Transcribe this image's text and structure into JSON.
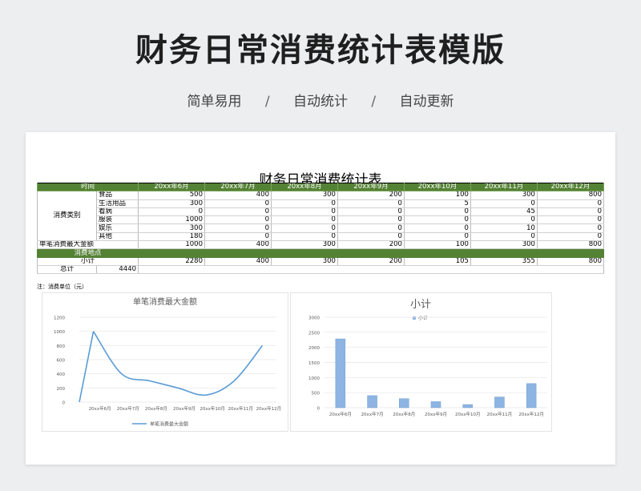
{
  "header": {
    "title": "财务日常消费统计表模版",
    "tags": [
      "简单易用",
      "自动统计",
      "自动更新"
    ],
    "separator": "/"
  },
  "sheet": {
    "title": "财务日常消费统计表",
    "columns": [
      "时间",
      "20xx年6月",
      "20xx年7月",
      "20xx年8月",
      "20xx年9月",
      "20xx年10月",
      "20xx年11月",
      "20xx年12月"
    ],
    "category_label": "消费类别",
    "categories": [
      {
        "name": "食品",
        "values": [
          "500",
          "400",
          "300",
          "200",
          "100",
          "300",
          "800"
        ]
      },
      {
        "name": "生活用品",
        "values": [
          "300",
          "0",
          "0",
          "0",
          "5",
          "0",
          "0"
        ]
      },
      {
        "name": "看病",
        "values": [
          "0",
          "0",
          "0",
          "0",
          "0",
          "45",
          "0"
        ]
      },
      {
        "name": "服装",
        "values": [
          "1000",
          "0",
          "0",
          "0",
          "0",
          "0",
          "0"
        ]
      },
      {
        "name": "娱乐",
        "values": [
          "300",
          "0",
          "0",
          "0",
          "0",
          "10",
          "0"
        ]
      },
      {
        "name": "其他",
        "values": [
          "180",
          "0",
          "0",
          "0",
          "0",
          "0",
          "0"
        ]
      }
    ],
    "max_row": {
      "label": "单笔消费最大金额",
      "values": [
        "1000",
        "400",
        "300",
        "200",
        "100",
        "300",
        "800"
      ]
    },
    "place_row": {
      "label": "消费地点"
    },
    "subtotal_row": {
      "label": "小计",
      "values": [
        "2280",
        "400",
        "300",
        "200",
        "105",
        "355",
        "800"
      ]
    },
    "total_row": {
      "label": "总计",
      "value": "4440"
    },
    "note": "注：消费单位（元）"
  },
  "chart_data": [
    {
      "type": "line",
      "title": "单笔消费最大金额",
      "categories": [
        "20xx年6月",
        "20xx年7月",
        "20xx年8月",
        "20xx年9月",
        "20xx年10月",
        "20xx年11月",
        "20xx年12月"
      ],
      "series": [
        {
          "name": "单笔消费最大金额",
          "values": [
            1000,
            400,
            300,
            200,
            100,
            300,
            800
          ]
        }
      ],
      "ylim": [
        0,
        1200
      ],
      "yticks": [
        0,
        200,
        400,
        600,
        800,
        1000,
        1200
      ],
      "smooth": true,
      "grid": true,
      "legend": "bottom",
      "color": "#5b9bd5"
    },
    {
      "type": "bar",
      "title": "小计",
      "categories": [
        "20xx年6月",
        "20xx年7月",
        "20xx年8月",
        "20xx年9月",
        "20xx年10月",
        "20xx年11月",
        "20xx年12月"
      ],
      "series": [
        {
          "name": "小计",
          "values": [
            2280,
            400,
            300,
            200,
            105,
            355,
            800
          ]
        }
      ],
      "ylim": [
        0,
        3000
      ],
      "yticks": [
        0,
        500,
        1000,
        1500,
        2000,
        2500,
        3000
      ],
      "grid": true,
      "legend": "top",
      "color": "#8db4e2"
    }
  ]
}
